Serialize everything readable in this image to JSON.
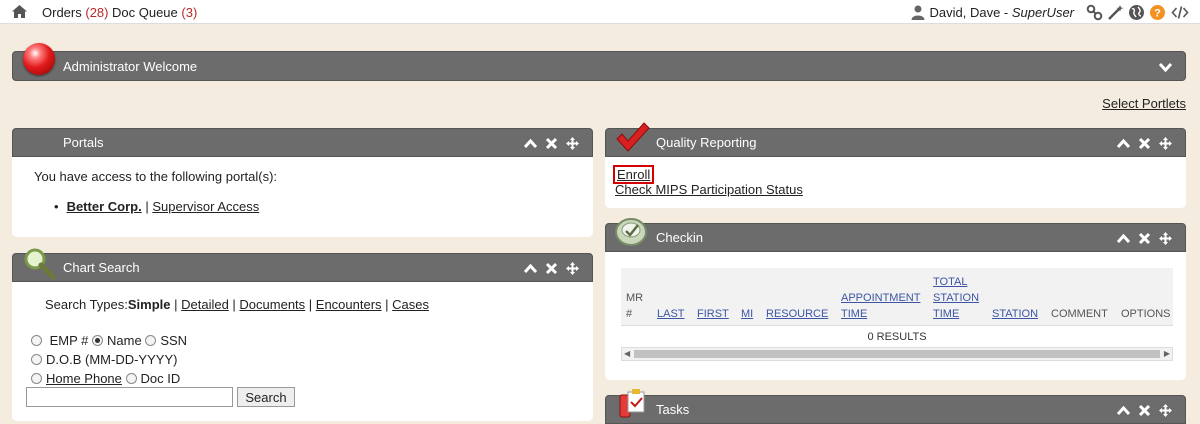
{
  "topbar": {
    "orders_label": "Orders",
    "orders_count": "(28)",
    "docqueue_label": "Doc Queue",
    "docqueue_count": "(3)",
    "user_name": "David, Dave - ",
    "user_role": "SuperUser"
  },
  "welcome": {
    "title": "Administrator Welcome"
  },
  "select_portlets": "Select Portlets",
  "portals": {
    "title": "Portals",
    "intro": "You have access to the following portal(s):",
    "item_name": "Better Corp.",
    "separator": "|",
    "item_link": "Supervisor Access"
  },
  "chart_search": {
    "title": "Chart Search",
    "types_label": "Search Types:",
    "types_current": "Simple",
    "types": [
      "Detailed",
      "Documents",
      "Encounters",
      "Cases"
    ],
    "opt_emp": "EMP #",
    "opt_name": "Name",
    "opt_ssn": "SSN",
    "opt_dob": "D.O.B (MM-DD-YYYY)",
    "opt_phone": "Home Phone",
    "opt_docid": "Doc ID",
    "search_value": "",
    "search_button": "Search"
  },
  "quality": {
    "title": "Quality Reporting",
    "enroll": "Enroll",
    "mips": "Check MIPS Participation Status"
  },
  "checkin": {
    "title": "Checkin",
    "columns": {
      "mr": [
        "MR",
        "#"
      ],
      "last": "LAST",
      "first": "FIRST",
      "mi": "MI",
      "resource": "RESOURCE",
      "appt": [
        "APPOINTMENT",
        "TIME"
      ],
      "total": [
        "TOTAL",
        "STATION",
        "TIME"
      ],
      "station": "STATION",
      "comment": "COMMENT",
      "options": "OPTIONS"
    },
    "results": "0 RESULTS"
  },
  "tasks": {
    "title": "Tasks"
  },
  "colors": {
    "header_bg": "#6c6c6c",
    "page_bg": "#f4ecdf",
    "accent_red": "#b52a2a",
    "help_orange": "#f29222"
  }
}
